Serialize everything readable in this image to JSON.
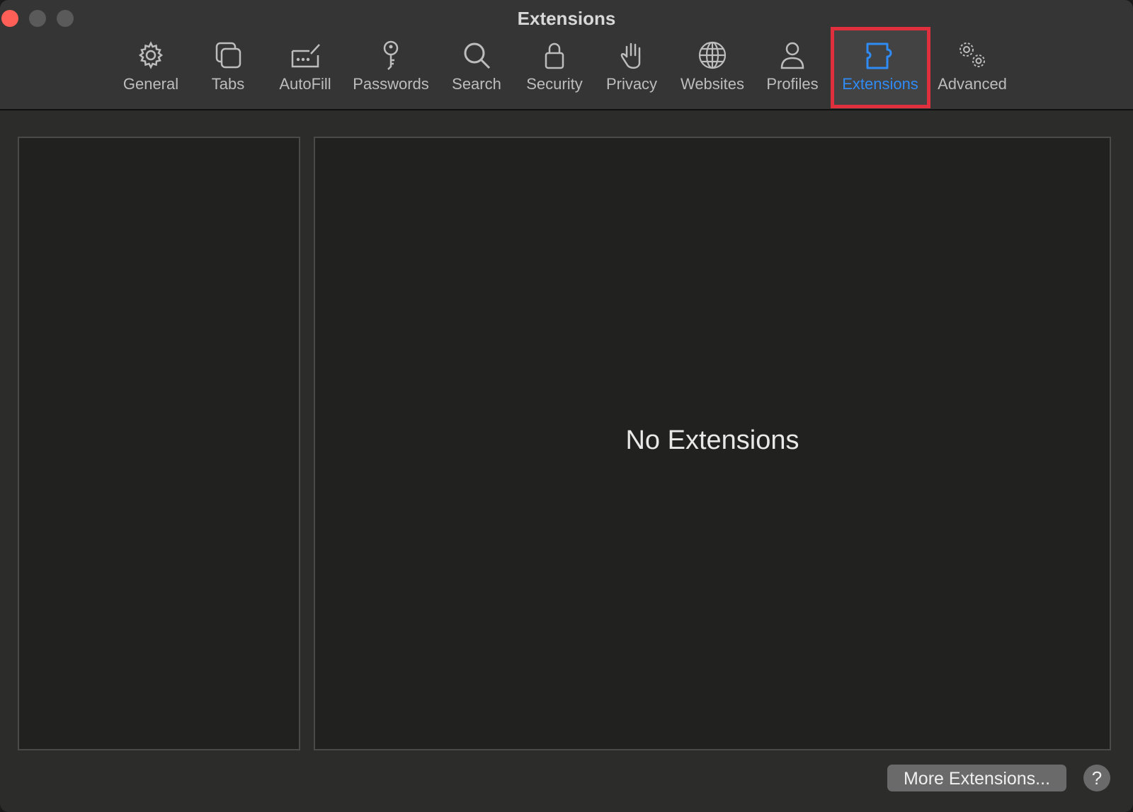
{
  "window": {
    "title": "Extensions"
  },
  "toolbar": {
    "tabs": [
      {
        "label": "General",
        "icon": "gear-icon"
      },
      {
        "label": "Tabs",
        "icon": "tabs-icon"
      },
      {
        "label": "AutoFill",
        "icon": "autofill-icon"
      },
      {
        "label": "Passwords",
        "icon": "key-icon"
      },
      {
        "label": "Search",
        "icon": "search-icon"
      },
      {
        "label": "Security",
        "icon": "lock-icon"
      },
      {
        "label": "Privacy",
        "icon": "hand-icon"
      },
      {
        "label": "Websites",
        "icon": "globe-icon"
      },
      {
        "label": "Profiles",
        "icon": "person-icon"
      },
      {
        "label": "Extensions",
        "icon": "puzzle-icon",
        "selected": true
      },
      {
        "label": "Advanced",
        "icon": "gears-icon"
      }
    ],
    "active_color": "#2f8bf5",
    "highlight_color": "#e0303e"
  },
  "main": {
    "empty_message": "No Extensions",
    "more_button_label": "More Extensions...",
    "help_label": "?"
  }
}
